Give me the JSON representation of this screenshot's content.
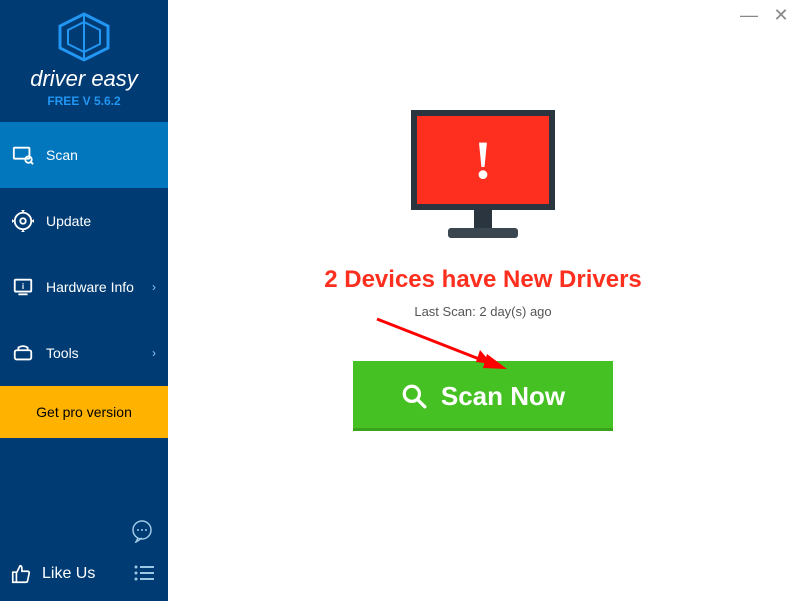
{
  "brand": {
    "name": "driver easy",
    "version": "FREE V 5.6.2"
  },
  "sidebar": {
    "items": [
      {
        "label": "Scan",
        "icon": "scan-icon",
        "active": true
      },
      {
        "label": "Update",
        "icon": "update-icon"
      },
      {
        "label": "Hardware Info",
        "icon": "hardware-icon",
        "expandable": true
      },
      {
        "label": "Tools",
        "icon": "tools-icon",
        "expandable": true
      }
    ],
    "pro": "Get pro version",
    "like": "Like Us"
  },
  "main": {
    "headline": "2 Devices have New Drivers",
    "lastscan": "Last Scan: 2 day(s) ago",
    "scan_button": "Scan Now"
  }
}
